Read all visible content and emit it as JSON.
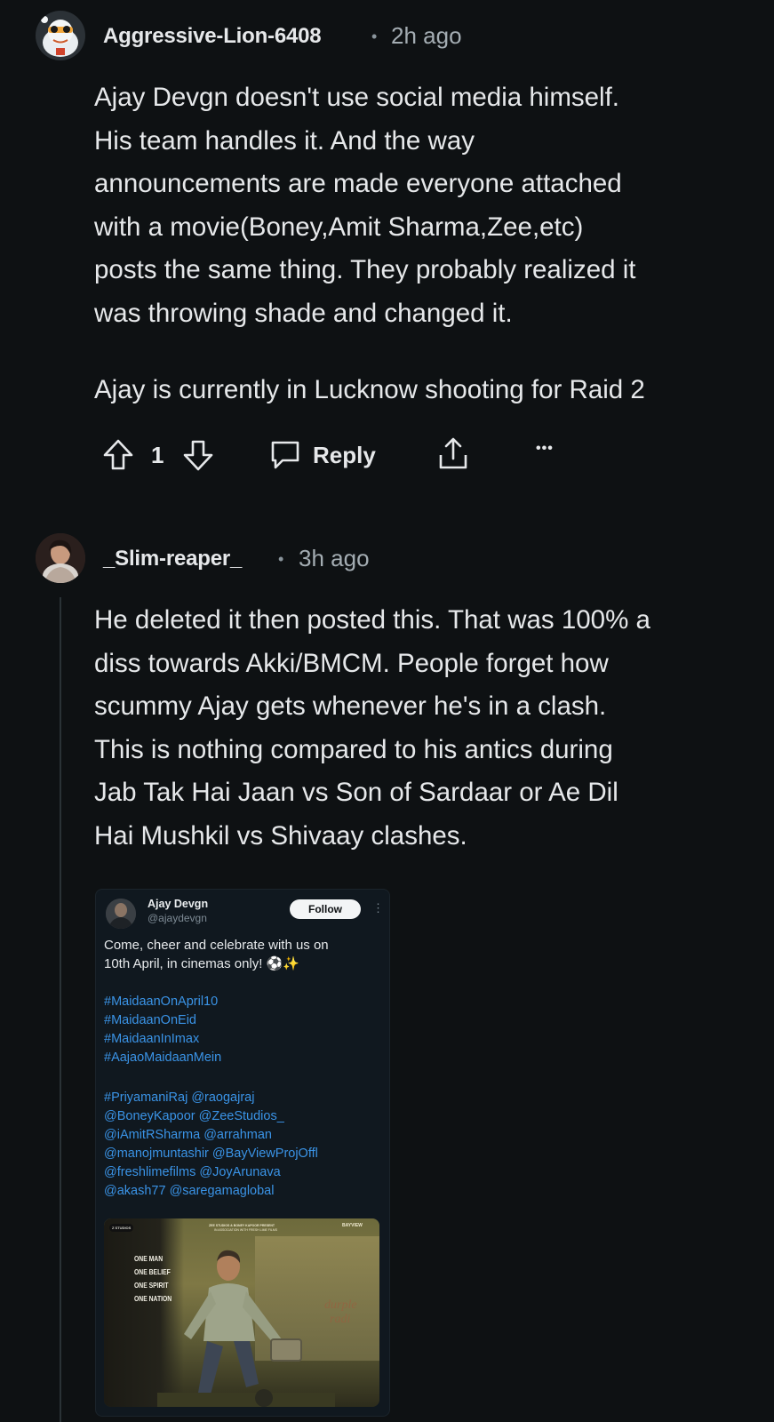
{
  "comment1": {
    "author": "Aggressive-Lion-6408",
    "separator": "•",
    "time": "2h ago",
    "paragraphs": [
      [
        "Ajay Devgn doesn't use social media himself.",
        "His team handles it. And the way",
        "announcements are made everyone attached",
        "with a movie(Boney,Amit Sharma,Zee,etc)",
        "posts the same thing. They probably realized it",
        "was throwing shade and changed it."
      ],
      [
        "Ajay is currently in Lucknow shooting for Raid 2"
      ]
    ],
    "actions": {
      "vote_count": "1",
      "reply_label": "Reply",
      "more_label": "•••"
    }
  },
  "comment2": {
    "author": "_Slim-reaper_",
    "separator": "•",
    "time": "3h ago",
    "lines": [
      "He deleted it then posted this. That was 100% a",
      "diss towards Akki/BMCM. People forget how",
      "scummy Ajay gets whenever he's in a clash.",
      "This is nothing compared to his antics during",
      "Jab Tak Hai Jaan vs Son of Sardaar or Ae Dil",
      "Hai Mushkil vs Shivaay clashes."
    ],
    "embed": {
      "name": "Ajay Devgn",
      "handle": "@ajaydevgn",
      "follow_label": "Follow",
      "menu": "⋮",
      "text_lines": [
        "Come, cheer and celebrate with us on",
        "10th April, in cinemas only! ⚽✨"
      ],
      "hashtags": [
        "#MaidaanOnApril10",
        "#MaidaanOnEid",
        "#MaidaanInImax",
        "#AajaoMaidaanMein"
      ],
      "mentions": [
        "#PriyamaniRaj @raogajraj",
        "@BoneyKapoor @ZeeStudios_",
        "@iAmitRSharma @arrahman",
        "@manojmuntashir @BayViewProjOffl",
        "@freshlimefilms @JoyArunava",
        "@akash77 @saregamaglobal"
      ],
      "poster": {
        "badge": "Z STUDIOS",
        "top_credit": "ZEE STUDIOS & BONEY KAPOOR PRESENT",
        "top_credit2": "IN ASSOCIATION WITH FRESH LIME FILMS",
        "brand_right": "BAYVIEW",
        "tagline": [
          "ONE MAN",
          "ONE BELIEF",
          "ONE SPIRIT",
          "ONE NATION"
        ],
        "wall_text": [
          "durple",
          "radi"
        ]
      }
    }
  },
  "colors": {
    "background": "#0e1113",
    "text": "#e6e8ea",
    "muted": "#a4adb3",
    "link": "#3a93e6"
  }
}
